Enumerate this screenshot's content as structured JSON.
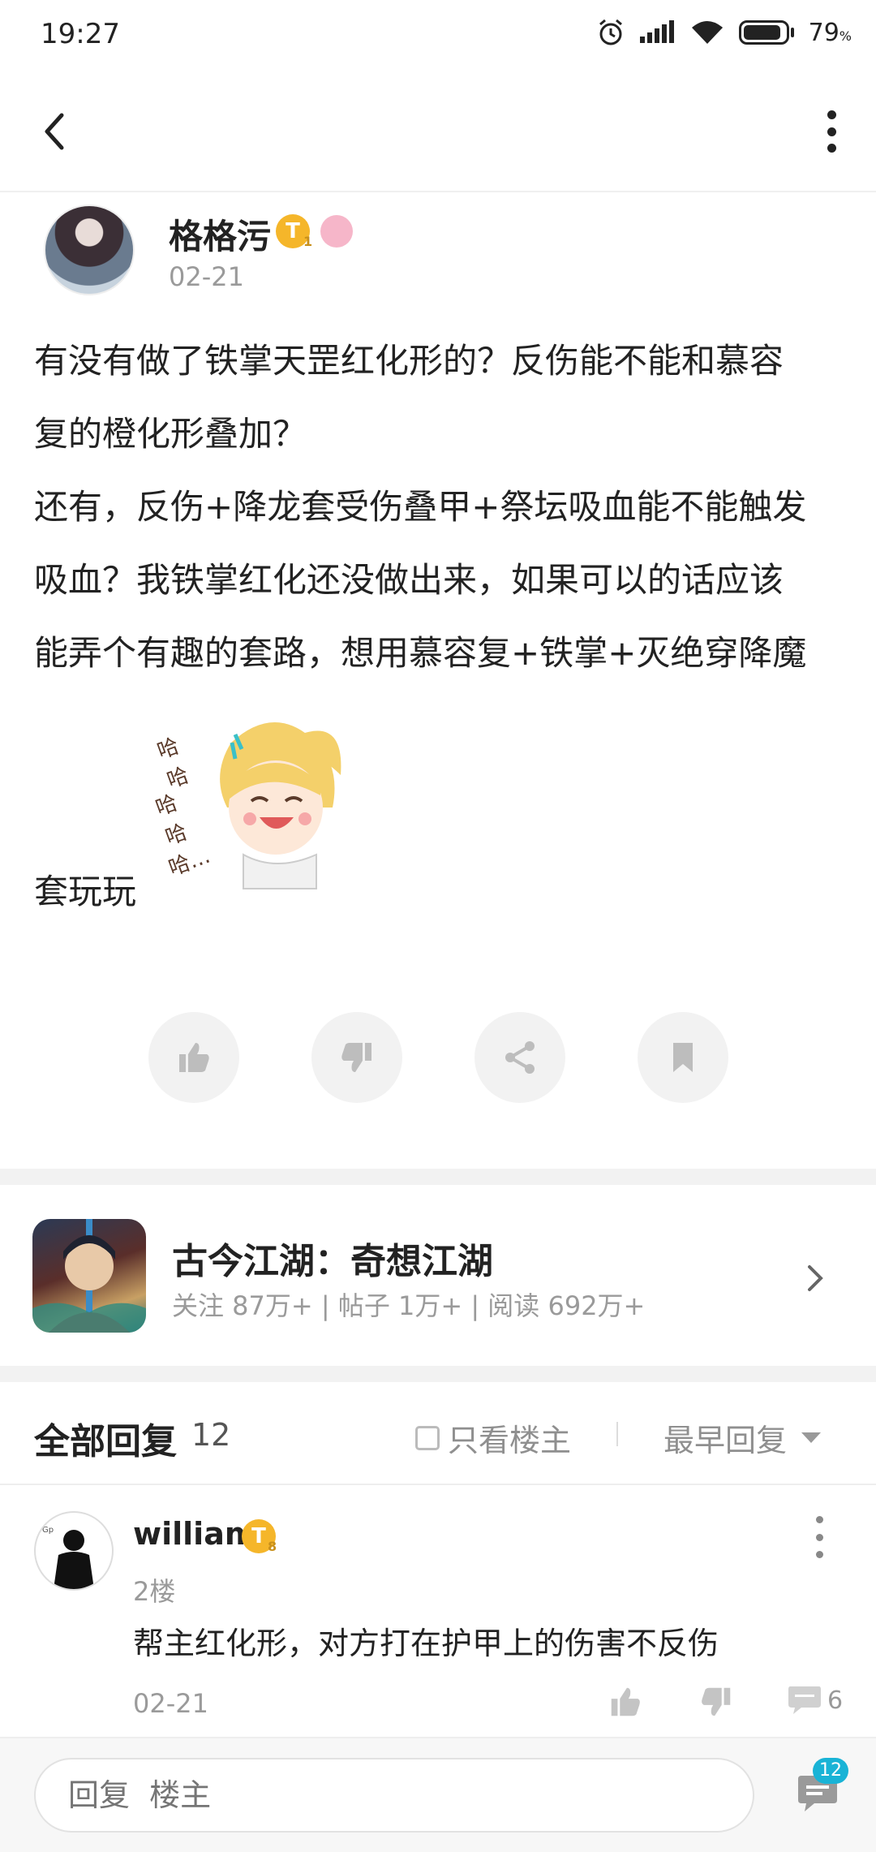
{
  "status": {
    "time": "19:27",
    "battery": "79",
    "battery_unit": "%"
  },
  "post": {
    "author": "格格污",
    "author_badge": "T",
    "author_badge_level": "1",
    "date": "02-21",
    "lines": [
      "有没有做了铁掌天罡红化形的？反伤能不能和慕容",
      "复的橙化形叠加？",
      "还有，反伤+降龙套受伤叠甲+祭坛吸血能不能触发",
      "吸血？我铁掌红化还没做出来，如果可以的话应该",
      "能弄个有趣的套路，想用慕容复+铁掌+灭绝穿降魔"
    ],
    "tail": "套玩玩",
    "sticker_text": "哈哈哈哈哈…"
  },
  "forum": {
    "name": "古今江湖：奇想江湖",
    "stats": "关注 87万+ | 帖子 1万+ | 阅读 692万+"
  },
  "replies": {
    "title": "全部回复",
    "count": "12",
    "only_owner": "只看楼主",
    "sort": "最早回复"
  },
  "reply": {
    "name": "william",
    "badge": "T",
    "badge_level": "8",
    "floor": "2楼",
    "text": "帮主红化形，对方打在护甲上的伤害不反伤",
    "date": "02-21",
    "comment_count": "6"
  },
  "bottom": {
    "placeholder": "回复  楼主",
    "badge": "12"
  },
  "colors": {
    "accent": "#19b3d6",
    "badge_gold": "#f5b62a"
  }
}
